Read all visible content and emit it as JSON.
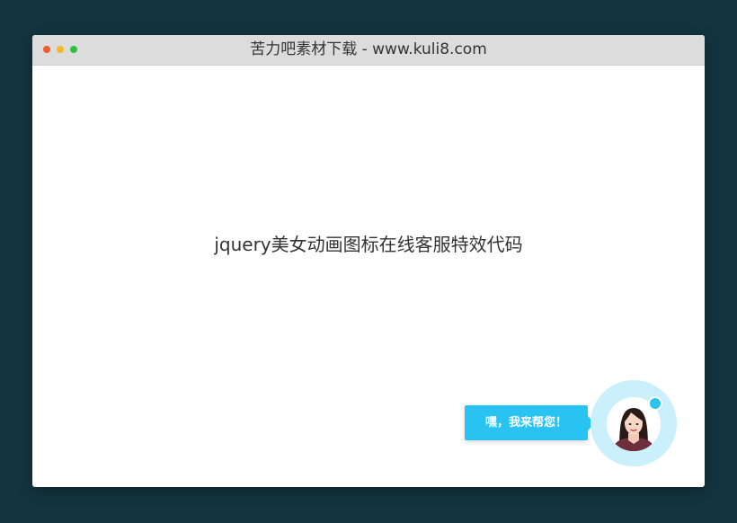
{
  "window": {
    "title": "苦力吧素材下载 - www.kuli8.com",
    "controls": [
      {
        "name": "close",
        "color": "#f0592a"
      },
      {
        "name": "minimize",
        "color": "#f5b824"
      },
      {
        "name": "maximize",
        "color": "#2bc33e"
      }
    ]
  },
  "main": {
    "heading": "jquery美女动画图标在线客服特效代码"
  },
  "chat_widget": {
    "bubble_text": "嘿，我来帮您！",
    "bubble_color": "#29c3f2",
    "halo_color": "#c9f0fb",
    "status_color": "#29c3f2",
    "avatar_icon": "agent-avatar-icon"
  }
}
